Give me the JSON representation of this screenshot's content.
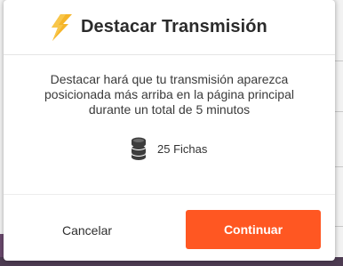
{
  "dialog": {
    "title": "Destacar Transmisión",
    "title_icon": "lightning-bolt-icon",
    "description": "Destacar hará que tu transmisión aparezca posicionada más arriba en la página principal durante un total de 5 minutos",
    "cost": {
      "icon": "coins-stack-icon",
      "label": "25 Fichas"
    },
    "buttons": {
      "cancel_label": "Cancelar",
      "continue_label": "Continuar"
    }
  },
  "colors": {
    "accent": "#ff5722",
    "bolt": "#f5b52a",
    "title_text": "#2b2b2b",
    "body_text": "#3a3a3a",
    "coins": "#3d3d3d"
  }
}
